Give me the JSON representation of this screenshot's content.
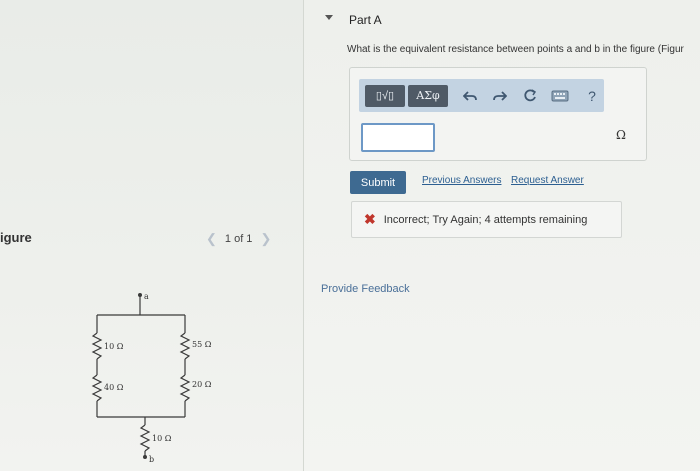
{
  "figure_panel": {
    "title": "igure",
    "pager_text": "1 of 1",
    "prev_icon": "chevron-left-icon",
    "next_icon": "chevron-right-icon",
    "circuit": {
      "node_a": "a",
      "node_b": "b",
      "r_left_top": "10 Ω",
      "r_left_bottom": "40 Ω",
      "r_right_top": "55 Ω",
      "r_right_bottom": "20 Ω",
      "r_bottom": "10 Ω"
    }
  },
  "part": {
    "title": "Part A",
    "question": "What is the equivalent resistance between points a and b in the figure (Figur",
    "toolbar": {
      "template_label": "▯√▯",
      "greek_label": "ΑΣφ",
      "icons": [
        "undo-icon",
        "redo-icon",
        "reset-icon",
        "keyboard-icon",
        "help-icon"
      ],
      "help_label": "?"
    },
    "input_value": "",
    "unit": "Ω",
    "submit_label": "Submit",
    "previous_answers_label": "Previous Answers",
    "request_answer_label": "Request Answer",
    "feedback_text": "Incorrect; Try Again; 4 attempts remaining",
    "status_color": "#c0362c",
    "provide_feedback_label": "Provide Feedback"
  }
}
